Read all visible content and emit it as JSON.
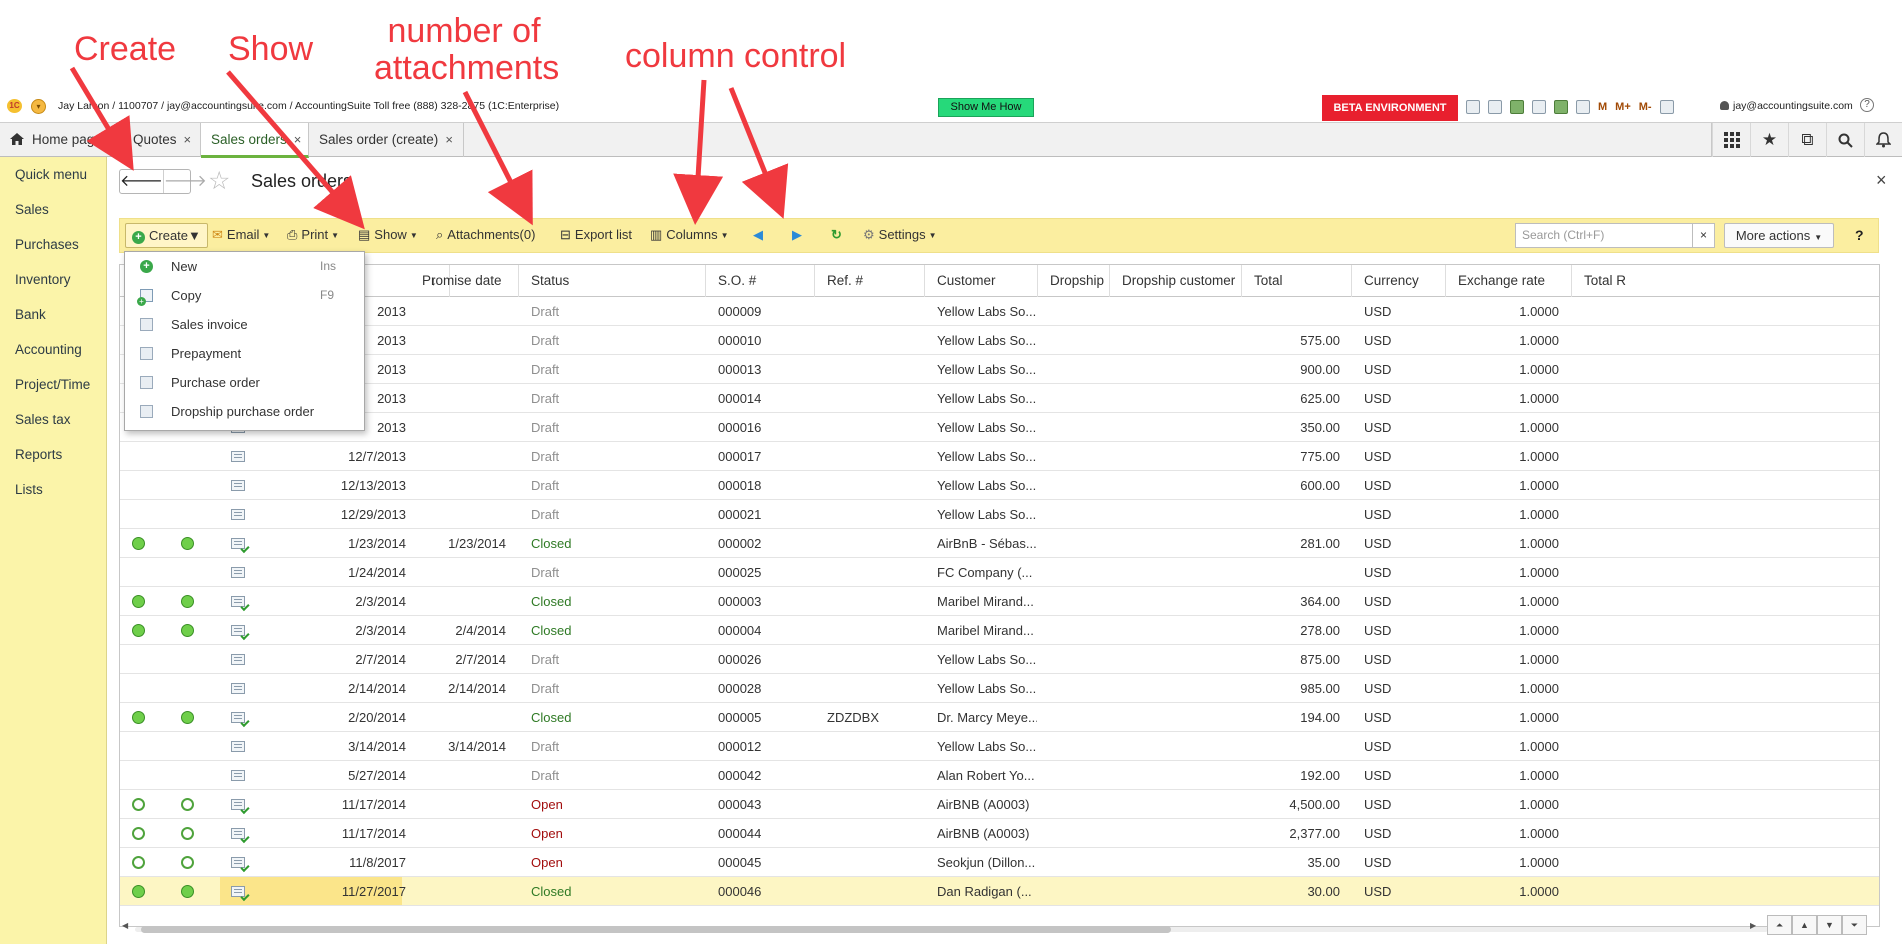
{
  "annotations": {
    "create": "Create",
    "show": "Show",
    "attachments_line1": "number of",
    "attachments_line2": "attachments",
    "column_control": "column control",
    "color": "#f0393f"
  },
  "topbar": {
    "user_info": "Jay Larson / 1100707 / jay@accountingsuite.com / AccountingSuite Toll free (888) 328-2875   (1C:Enterprise)",
    "show_me_how": "Show Me How",
    "beta": "BETA ENVIRONMENT",
    "memory_buttons": [
      "M",
      "M+",
      "M-"
    ],
    "account": "jay@accountingsuite.com",
    "help": "?"
  },
  "tabs": [
    {
      "label": "Home page",
      "icon": "home-icon"
    },
    {
      "label": "Quotes"
    },
    {
      "label": "Sales orders",
      "active": true
    },
    {
      "label": "Sales order (create)"
    }
  ],
  "sidebar": {
    "items": [
      "Quick menu",
      "Sales",
      "Purchases",
      "Inventory",
      "Bank",
      "Accounting",
      "Project/Time",
      "Sales tax",
      "Reports",
      "Lists"
    ]
  },
  "page": {
    "title": "Sales orders",
    "close": "×"
  },
  "toolbar": {
    "create": "Create",
    "email": "Email",
    "print": "Print",
    "show": "Show",
    "attachments": "Attachments(0)",
    "export": "Export list",
    "columns": "Columns",
    "settings": "Settings",
    "search_placeholder": "Search (Ctrl+F)",
    "clear": "×",
    "more_actions": "More actions",
    "help": "?"
  },
  "create_menu": [
    {
      "label": "New",
      "shortcut": "Ins",
      "icon": "plus-circle-icon"
    },
    {
      "label": "Copy",
      "shortcut": "F9",
      "icon": "copy-icon"
    },
    {
      "label": "Sales invoice",
      "icon": "document-icon"
    },
    {
      "label": "Prepayment",
      "icon": "document-icon"
    },
    {
      "label": "Purchase order",
      "icon": "document-icon"
    },
    {
      "label": "Dropship purchase order",
      "icon": "document-icon"
    }
  ],
  "table": {
    "sort_indicator": "↓",
    "columns": [
      "Promise date",
      "Status",
      "S.O. #",
      "Ref. #",
      "Customer",
      "Dropship",
      "Dropship customer",
      "Total",
      "Currency",
      "Exchange rate",
      "Total R"
    ],
    "rows": [
      {
        "c1": "",
        "c2": "",
        "doc": "plain",
        "date": "2013",
        "promise": "",
        "status": "Draft",
        "so": "000009",
        "ref": "",
        "customer": "Yellow Labs So...",
        "total": "",
        "currency": "USD",
        "rate": "1.0000"
      },
      {
        "c1": "",
        "c2": "",
        "doc": "plain",
        "date": "2013",
        "promise": "",
        "status": "Draft",
        "so": "000010",
        "ref": "",
        "customer": "Yellow Labs So...",
        "total": "575.00",
        "currency": "USD",
        "rate": "1.0000"
      },
      {
        "c1": "",
        "c2": "",
        "doc": "plain",
        "date": "2013",
        "promise": "",
        "status": "Draft",
        "so": "000013",
        "ref": "",
        "customer": "Yellow Labs So...",
        "total": "900.00",
        "currency": "USD",
        "rate": "1.0000"
      },
      {
        "c1": "",
        "c2": "",
        "doc": "plain",
        "date": "2013",
        "promise": "",
        "status": "Draft",
        "so": "000014",
        "ref": "",
        "customer": "Yellow Labs So...",
        "total": "625.00",
        "currency": "USD",
        "rate": "1.0000"
      },
      {
        "c1": "",
        "c2": "",
        "doc": "plain",
        "date": "2013",
        "promise": "",
        "status": "Draft",
        "so": "000016",
        "ref": "",
        "customer": "Yellow Labs So...",
        "total": "350.00",
        "currency": "USD",
        "rate": "1.0000"
      },
      {
        "c1": "",
        "c2": "",
        "doc": "plain",
        "date": "12/7/2013",
        "promise": "",
        "status": "Draft",
        "so": "000017",
        "ref": "",
        "customer": "Yellow Labs So...",
        "total": "775.00",
        "currency": "USD",
        "rate": "1.0000"
      },
      {
        "c1": "",
        "c2": "",
        "doc": "plain",
        "date": "12/13/2013",
        "promise": "",
        "status": "Draft",
        "so": "000018",
        "ref": "",
        "customer": "Yellow Labs So...",
        "total": "600.00",
        "currency": "USD",
        "rate": "1.0000"
      },
      {
        "c1": "",
        "c2": "",
        "doc": "plain",
        "date": "12/29/2013",
        "promise": "",
        "status": "Draft",
        "so": "000021",
        "ref": "",
        "customer": "Yellow Labs So...",
        "total": "",
        "currency": "USD",
        "rate": "1.0000"
      },
      {
        "c1": "full",
        "c2": "full",
        "doc": "check",
        "date": "1/23/2014",
        "promise": "1/23/2014",
        "status": "Closed",
        "so": "000002",
        "ref": "",
        "customer": "AirBnB - Sébas...",
        "total": "281.00",
        "currency": "USD",
        "rate": "1.0000"
      },
      {
        "c1": "",
        "c2": "",
        "doc": "plain",
        "date": "1/24/2014",
        "promise": "",
        "status": "Draft",
        "so": "000025",
        "ref": "",
        "customer": "FC Company (...",
        "total": "",
        "currency": "USD",
        "rate": "1.0000"
      },
      {
        "c1": "full",
        "c2": "full",
        "doc": "check",
        "date": "2/3/2014",
        "promise": "",
        "status": "Closed",
        "so": "000003",
        "ref": "",
        "customer": "Maribel Mirand...",
        "total": "364.00",
        "currency": "USD",
        "rate": "1.0000"
      },
      {
        "c1": "full",
        "c2": "full",
        "doc": "check",
        "date": "2/3/2014",
        "promise": "2/4/2014",
        "status": "Closed",
        "so": "000004",
        "ref": "",
        "customer": "Maribel Mirand...",
        "total": "278.00",
        "currency": "USD",
        "rate": "1.0000"
      },
      {
        "c1": "",
        "c2": "",
        "doc": "plain",
        "date": "2/7/2014",
        "promise": "2/7/2014",
        "status": "Draft",
        "so": "000026",
        "ref": "",
        "customer": "Yellow Labs So...",
        "total": "875.00",
        "currency": "USD",
        "rate": "1.0000"
      },
      {
        "c1": "",
        "c2": "",
        "doc": "plain",
        "date": "2/14/2014",
        "promise": "2/14/2014",
        "status": "Draft",
        "so": "000028",
        "ref": "",
        "customer": "Yellow Labs So...",
        "total": "985.00",
        "currency": "USD",
        "rate": "1.0000"
      },
      {
        "c1": "full",
        "c2": "full",
        "doc": "check",
        "date": "2/20/2014",
        "promise": "",
        "status": "Closed",
        "so": "000005",
        "ref": "ZDZDBX",
        "customer": "Dr. Marcy Meye...",
        "total": "194.00",
        "currency": "USD",
        "rate": "1.0000"
      },
      {
        "c1": "",
        "c2": "",
        "doc": "plain",
        "date": "3/14/2014",
        "promise": "3/14/2014",
        "status": "Draft",
        "so": "000012",
        "ref": "",
        "customer": "Yellow Labs So...",
        "total": "",
        "currency": "USD",
        "rate": "1.0000"
      },
      {
        "c1": "",
        "c2": "",
        "doc": "plain",
        "date": "5/27/2014",
        "promise": "",
        "status": "Draft",
        "so": "000042",
        "ref": "",
        "customer": "Alan Robert Yo...",
        "total": "192.00",
        "currency": "USD",
        "rate": "1.0000"
      },
      {
        "c1": "ring",
        "c2": "ring",
        "doc": "check",
        "date": "11/17/2014",
        "promise": "",
        "status": "Open",
        "so": "000043",
        "ref": "",
        "customer": "AirBNB (A0003)",
        "total": "4,500.00",
        "currency": "USD",
        "rate": "1.0000"
      },
      {
        "c1": "ring",
        "c2": "ring",
        "doc": "check",
        "date": "11/17/2014",
        "promise": "",
        "status": "Open",
        "so": "000044",
        "ref": "",
        "customer": "AirBNB (A0003)",
        "total": "2,377.00",
        "currency": "USD",
        "rate": "1.0000"
      },
      {
        "c1": "ring",
        "c2": "ring",
        "doc": "check",
        "date": "11/8/2017",
        "promise": "",
        "status": "Open",
        "so": "000045",
        "ref": "",
        "customer": "Seokjun (Dillon...",
        "total": "35.00",
        "currency": "USD",
        "rate": "1.0000"
      },
      {
        "c1": "full",
        "c2": "full",
        "doc": "check",
        "date": "11/27/2017",
        "promise": "",
        "status": "Closed",
        "so": "000046",
        "ref": "",
        "customer": "Dan Radigan (...",
        "total": "30.00",
        "currency": "USD",
        "rate": "1.0000",
        "selected": true
      }
    ]
  }
}
